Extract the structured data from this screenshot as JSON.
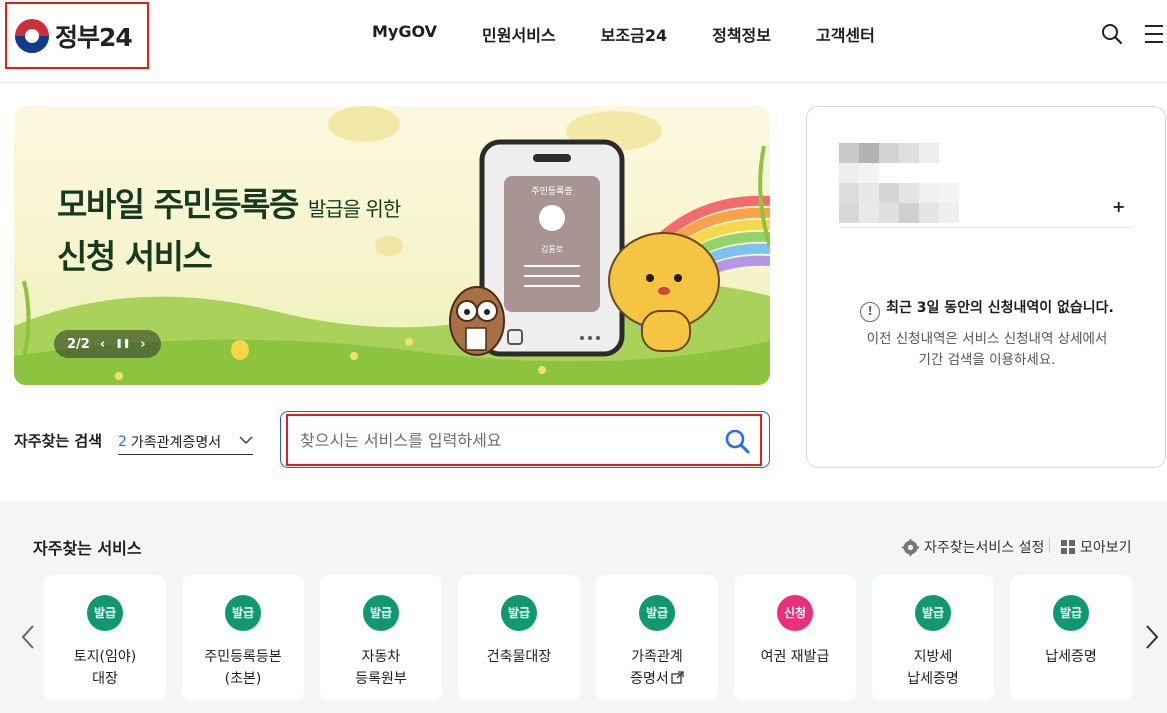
{
  "header": {
    "logo_text": "정부24",
    "nav": [
      "MyGOV",
      "민원서비스",
      "보조금24",
      "정책정보",
      "고객센터"
    ]
  },
  "banner": {
    "title_line1": "모바일 주민등록증",
    "title_line1_sub": "발급을 위한",
    "title_line2": "신청 서비스",
    "page_indicator": "2/2",
    "card_title": "주민등록증",
    "card_name": "김통로"
  },
  "search": {
    "label": "자주찾는 검색",
    "keyword_rank": "2",
    "keyword": "가족관계증명서",
    "placeholder": "찾으시는 서비스를 입력하세요"
  },
  "panel": {
    "notice_title": "최근 3일 동안의 신청내역이 없습니다.",
    "notice_line1": "이전 신청내역은 서비스 신청내역 상세에서",
    "notice_line2": "기간 검색을 이용하세요.",
    "plus": "+"
  },
  "services": {
    "title": "자주찾는 서비스",
    "settings_label": "자주찾는서비스 설정",
    "view_all_label": "모아보기",
    "items": [
      {
        "badge": "발급",
        "label": "토지(임야)\n대장"
      },
      {
        "badge": "발급",
        "label": "주민등록등본\n(초본)"
      },
      {
        "badge": "발급",
        "label": "자동차\n등록원부"
      },
      {
        "badge": "발급",
        "label": "건축물대장"
      },
      {
        "badge": "발급",
        "label": "가족관계\n증명서"
      },
      {
        "badge": "신청",
        "label": "여권 재발급"
      },
      {
        "badge": "발급",
        "label": "지방세\n납세증명"
      },
      {
        "badge": "발급",
        "label": "납세증명"
      }
    ]
  },
  "colors": {
    "badge_green": "#109870",
    "badge_pink": "#ec2f7d",
    "accent_blue": "#256ef4",
    "highlight_red": "#e0201b"
  }
}
